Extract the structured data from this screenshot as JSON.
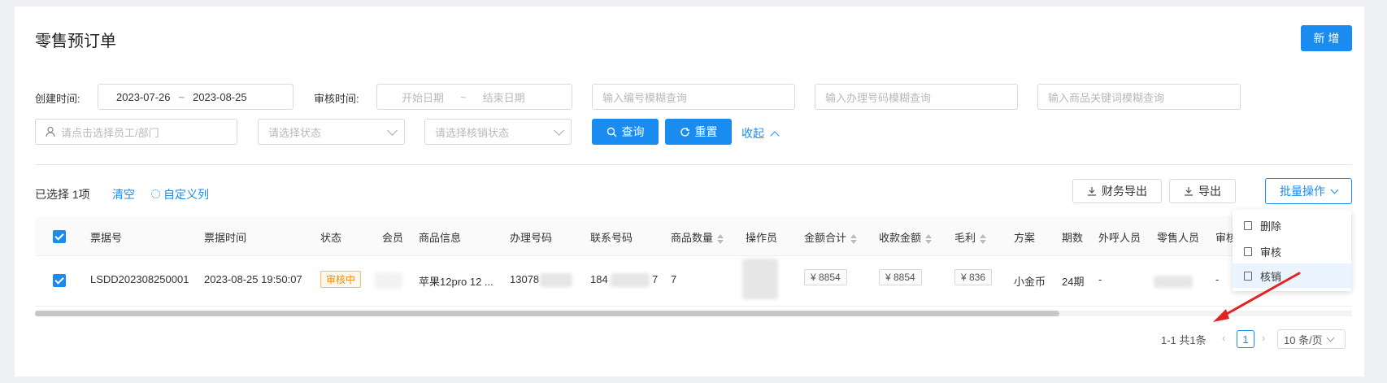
{
  "page": {
    "title": "零售预订单",
    "new_button": "新 增"
  },
  "filters": {
    "create_time_label": "创建时间:",
    "create_start": "2023-07-26",
    "range_sep": "~",
    "create_end": "2023-08-25",
    "audit_time_label": "审核时间:",
    "audit_start_ph": "开始日期",
    "audit_end_ph": "结束日期",
    "code_ph": "输入编号模糊查询",
    "handle_no_ph": "输入办理号码模糊查询",
    "goods_kw_ph": "输入商品关键词模糊查询",
    "staff_ph": "请点击选择员工/部门",
    "status_ph": "请选择状态",
    "writeoff_ph": "请选择核销状态",
    "query_button": "查询",
    "reset_button": "重置",
    "collapse_link": "收起"
  },
  "toolbar": {
    "selected_text": "已选择 1项",
    "clear_link": "清空",
    "custom_cols": "自定义列",
    "finance_export": "财务导出",
    "export": "导出",
    "batch_ops": "批量操作"
  },
  "table": {
    "columns": [
      "票据号",
      "票据时间",
      "状态",
      "会员",
      "商品信息",
      "办理号码",
      "联系号码",
      "商品数量",
      "操作员",
      "金额合计",
      "收款金额",
      "毛利",
      "方案",
      "期数",
      "外呼人员",
      "零售人员",
      "审核"
    ],
    "row": {
      "receipt_no": "LSDD202308250001",
      "receipt_time": "2023-08-25 19:50:07",
      "status": "审核中",
      "goods": "苹果12pro 12 ...",
      "handle_no": "13078",
      "contact_no_a": "184",
      "contact_no_b": "7",
      "qty": "7",
      "amount_total": "¥ 8854",
      "amount_received": "¥ 8854",
      "profit": "¥ 836",
      "plan": "小金币",
      "periods": "24期",
      "caller": "-",
      "audit_dash": "-"
    }
  },
  "batch_menu": {
    "items": [
      "删除",
      "审核",
      "核销"
    ]
  },
  "pagination": {
    "summary": "1-1 共1条",
    "page": "1",
    "page_size": "10 条/页"
  },
  "colors": {
    "primary": "#1a8cf0",
    "annotation_arrow": "#e52222"
  }
}
